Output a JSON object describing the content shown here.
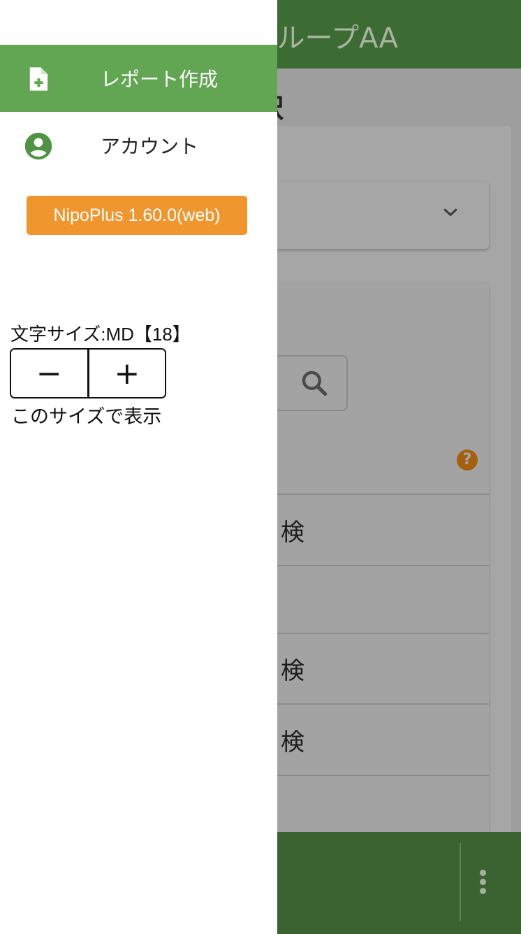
{
  "background_app": {
    "header_title": "ループAA",
    "section_heading": "選択",
    "rows": [
      "検",
      "検",
      "検"
    ]
  },
  "drawer": {
    "items": [
      {
        "label": "レポート作成",
        "icon": "file-add-icon",
        "active": true
      },
      {
        "label": "アカウント",
        "icon": "account-circle-icon",
        "active": false
      }
    ],
    "version_button": "NipoPlus 1.60.0(web)",
    "font_size": {
      "label": "文字サイズ:MD【18】",
      "decrease": "−",
      "increase": "+",
      "preview": "このサイズで表示"
    }
  },
  "colors": {
    "drawer_active": "#62a653",
    "version_button": "#f0962e",
    "header": "#3c6b33"
  }
}
